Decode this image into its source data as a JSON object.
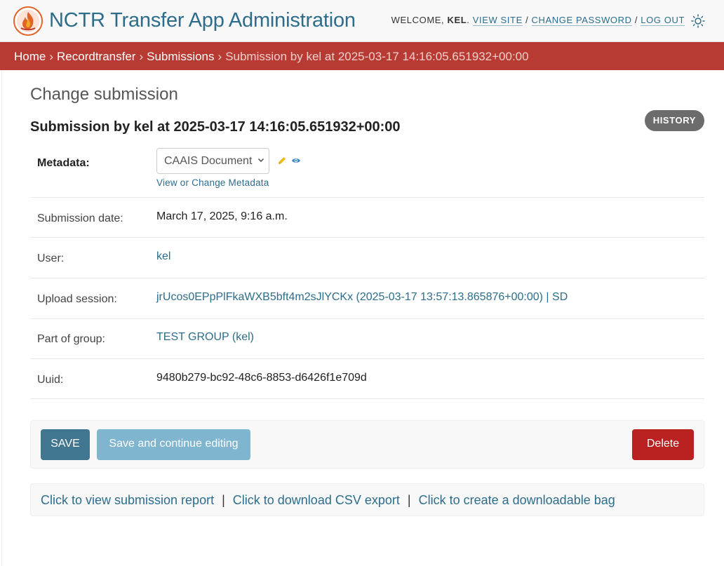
{
  "header": {
    "site_title": "NCTR Transfer App Administration",
    "welcome_prefix": "Welcome,",
    "username": "kel",
    "view_site": "View site",
    "change_password": "Change password",
    "log_out": "Log out",
    "separator": "/"
  },
  "breadcrumbs": {
    "items": [
      "Home",
      "Recordtransfer",
      "Submissions"
    ],
    "current": "Submission by kel at 2025-03-17 14:16:05.651932+00:00",
    "separator": "›"
  },
  "content": {
    "page_title": "Change submission",
    "object_title": "Submission by kel at 2025-03-17 14:16:05.651932+00:00",
    "history_label": "History"
  },
  "form": {
    "metadata": {
      "label": "Metadata:",
      "selected": "CAAIS Document",
      "link": "View or Change Metadata"
    },
    "rows": [
      {
        "label": "Submission date:",
        "value": "March 17, 2025, 9:16 a.m."
      },
      {
        "label": "User:",
        "value": "kel"
      },
      {
        "label": "Upload session:",
        "value": "jrUcos0EPpPlFkaWXB5bft4m2sJlYCKx (2025-03-17 13:57:13.865876+00:00) | SD"
      },
      {
        "label": "Part of group:",
        "value": "TEST GROUP (kel)"
      },
      {
        "label": "Uuid:",
        "value": "9480b279-bc92-48c6-8853-d6426f1e709d"
      }
    ]
  },
  "submit_row": {
    "save": "SAVE",
    "save_continue": "Save and continue editing",
    "delete": "Delete"
  },
  "actions": {
    "view_report": "Click to view submission report",
    "download_csv": "Click to download CSV export",
    "create_bag": "Click to create a downloadable bag",
    "separator": "|"
  },
  "colors": {
    "header_bg": "#f8f8f8",
    "title_blue": "#2d6d8b",
    "breadcrumb_bg": "#b83b33",
    "save_bg": "#417690",
    "continue_bg": "#7fb5cf",
    "delete_bg": "#ba2121",
    "history_bg": "#6c6c6c"
  },
  "icons": {
    "logo": "flame-logo",
    "theme": "sun-icon",
    "edit": "pencil-icon",
    "view": "eye-icon",
    "select": "chevron-down-icon"
  }
}
